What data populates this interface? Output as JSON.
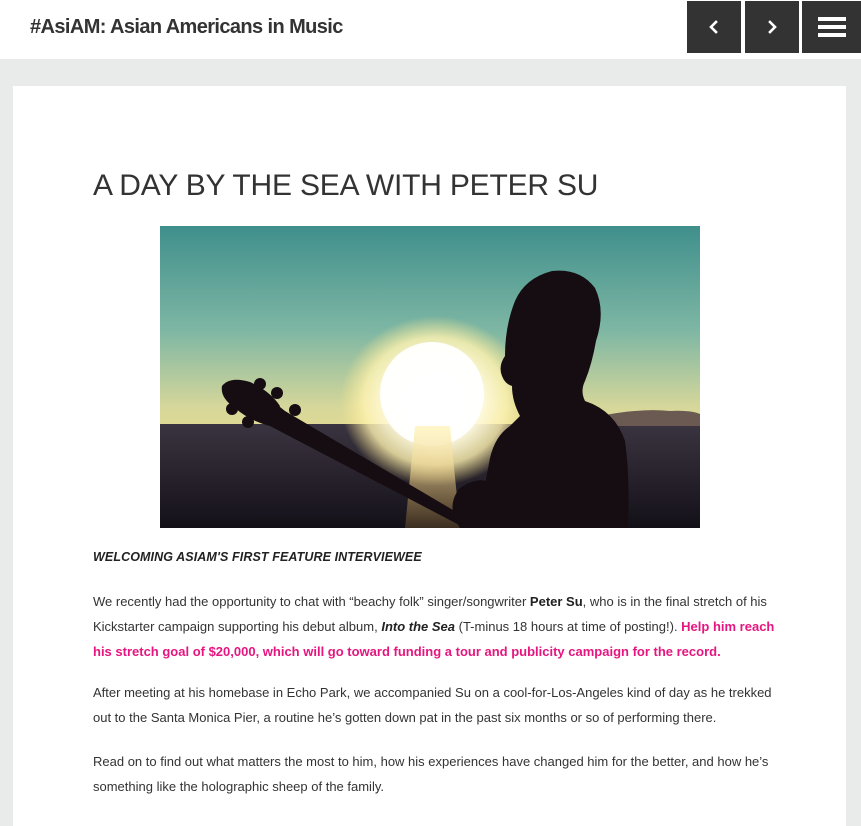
{
  "header": {
    "site_title": "#AsiAM: Asian Americans in Music",
    "prev_icon": "chevron-left-icon",
    "next_icon": "chevron-right-icon",
    "menu_icon": "hamburger-menu-icon"
  },
  "post": {
    "title": "A DAY BY THE SEA WITH PETER SU",
    "hero_image": "silhouette-guitarist-sunset-sea",
    "subheading": "WELCOMING ASIAM'S FIRST FEATURE INTERVIEWEE",
    "p1": {
      "t1": "We recently had the opportunity to chat with “beachy folk” singer/songwriter ",
      "name": "Peter Su",
      "t2": ", who is in the final stretch of his Kickstarter campaign supporting his debut album, ",
      "album": "Into the Sea",
      "t3": " (T-minus 18 hours at time of posting!). ",
      "link": "Help him reach his stretch goal of $20,000, which will go toward funding a tour and publicity campaign for the record."
    },
    "p2": "After meeting at his homebase in Echo Park, we accompanied Su on a cool-for-Los-Angeles kind of day as he trekked out to the Santa Monica Pier, a routine he’s gotten down pat in the past six months or so of performing there.",
    "p3": "Read on to find out what matters the most to him, how his experiences have changed him for the better, and how he’s something like the holographic sheep of the family."
  },
  "colors": {
    "accent_pink": "#e6157f",
    "nav_button_bg": "#333333",
    "page_bg": "#e9ebeb"
  }
}
